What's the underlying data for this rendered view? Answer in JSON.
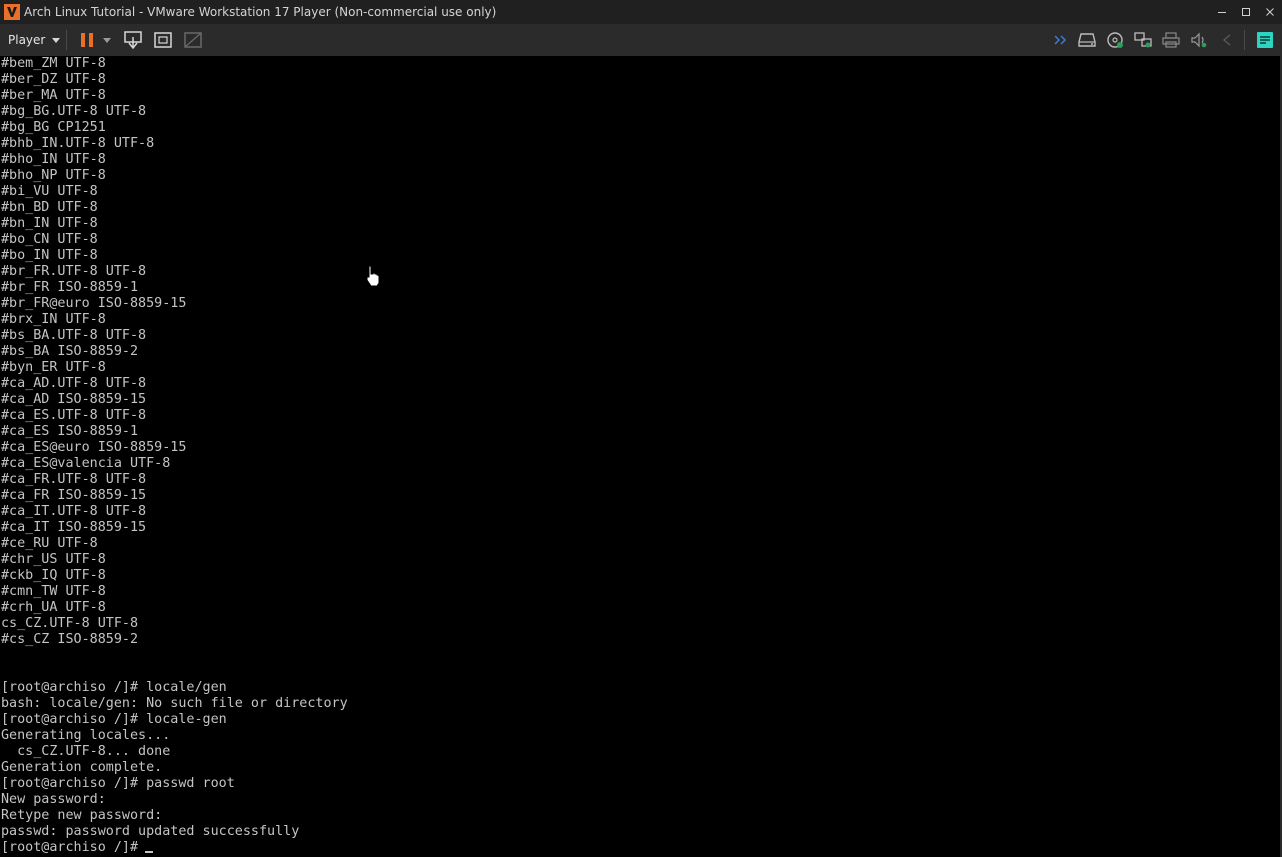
{
  "window": {
    "title": "Arch Linux Tutorial - VMware Workstation 17 Player (Non-commercial use only)"
  },
  "toolbar": {
    "player_label": "Player",
    "left_icons": [
      "pause-icon",
      "dropdown-icon",
      "send-ctrl-alt-del-icon",
      "fullscreen-icon",
      "unity-icon"
    ],
    "right_icons": [
      "double-chevron-icon",
      "hard-disk-icon",
      "cd-drive-icon",
      "network-adapter-icon",
      "printer-icon",
      "sound-icon",
      "usb-icon",
      "message-log-icon"
    ],
    "accent_color": "#e8702a",
    "message_icon_color": "#2dd4bf"
  },
  "console": {
    "lines": [
      "#bem_ZM UTF-8",
      "#ber_DZ UTF-8",
      "#ber_MA UTF-8",
      "#bg_BG.UTF-8 UTF-8",
      "#bg_BG CP1251",
      "#bhb_IN.UTF-8 UTF-8",
      "#bho_IN UTF-8",
      "#bho_NP UTF-8",
      "#bi_VU UTF-8",
      "#bn_BD UTF-8",
      "#bn_IN UTF-8",
      "#bo_CN UTF-8",
      "#bo_IN UTF-8",
      "#br_FR.UTF-8 UTF-8",
      "#br_FR ISO-8859-1",
      "#br_FR@euro ISO-8859-15",
      "#brx_IN UTF-8",
      "#bs_BA.UTF-8 UTF-8",
      "#bs_BA ISO-8859-2",
      "#byn_ER UTF-8",
      "#ca_AD.UTF-8 UTF-8",
      "#ca_AD ISO-8859-15",
      "#ca_ES.UTF-8 UTF-8",
      "#ca_ES ISO-8859-1",
      "#ca_ES@euro ISO-8859-15",
      "#ca_ES@valencia UTF-8",
      "#ca_FR.UTF-8 UTF-8",
      "#ca_FR ISO-8859-15",
      "#ca_IT.UTF-8 UTF-8",
      "#ca_IT ISO-8859-15",
      "#ce_RU UTF-8",
      "#chr_US UTF-8",
      "#ckb_IQ UTF-8",
      "#cmn_TW UTF-8",
      "#crh_UA UTF-8",
      "cs_CZ.UTF-8 UTF-8",
      "#cs_CZ ISO-8859-2",
      "",
      "",
      "[root@archiso /]# locale/gen",
      "bash: locale/gen: No such file or directory",
      "[root@archiso /]# locale-gen",
      "Generating locales...",
      "  cs_CZ.UTF-8... done",
      "Generation complete.",
      "[root@archiso /]# passwd root",
      "New password:",
      "Retype new password:",
      "passwd: password updated successfully",
      "[root@archiso /]# "
    ],
    "text_color": "#c4c4c4",
    "background_color": "#000000"
  }
}
